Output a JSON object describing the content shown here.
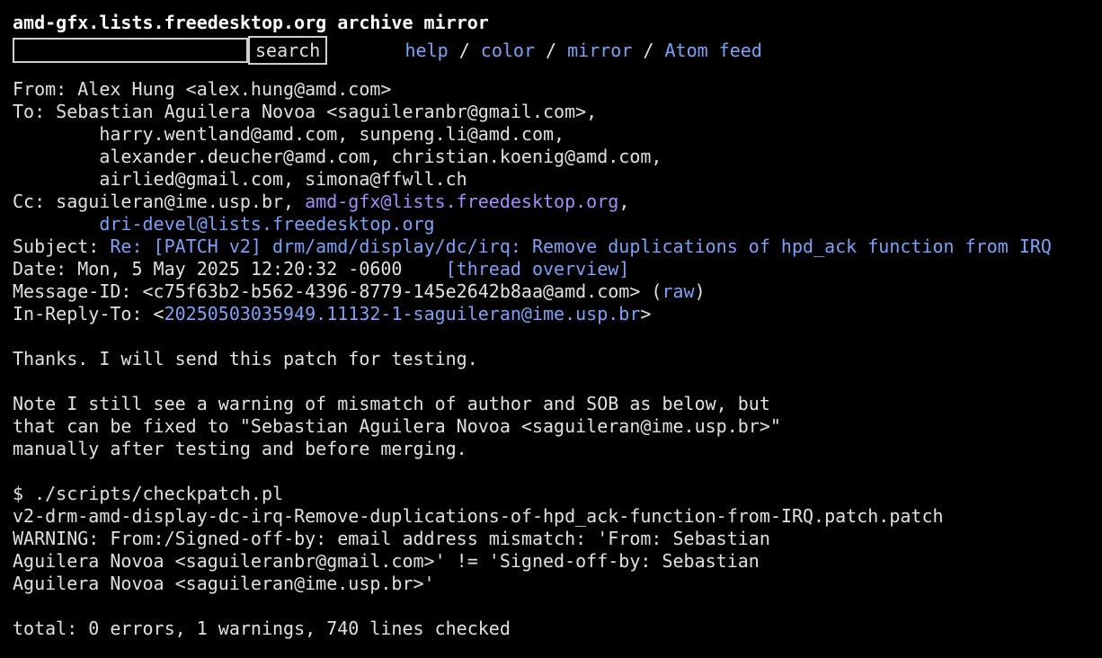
{
  "header": {
    "title": "amd-gfx.lists.freedesktop.org archive mirror",
    "search_button": "search",
    "search_value": "",
    "nav": [
      "help",
      "color",
      "mirror",
      "Atom feed"
    ],
    "sep": " / "
  },
  "message": {
    "from": "From: Alex Hung <alex.hung@amd.com>",
    "to_line1": "To: Sebastian Aguilera Novoa <saguileranbr@gmail.com>,",
    "to_line2": "        harry.wentland@amd.com, sunpeng.li@amd.com,",
    "to_line3": "        alexander.deucher@amd.com, christian.koenig@amd.com,",
    "to_line4": "        airlied@gmail.com, simona@ffwll.ch",
    "cc_prefix": "Cc: saguileran@ime.usp.br, ",
    "cc_link1": "amd-gfx@lists.freedesktop.org",
    "cc_sep": ",",
    "cc_indent": "        ",
    "cc_link2": "dri-devel@lists.freedesktop.org",
    "subject_prefix": "Subject: ",
    "subject_link": "Re: [PATCH v2] drm/amd/display/dc/irq: Remove duplications of hpd_ack function from IRQ",
    "date_text": "Date: Mon, 5 May 2025 12:20:32 -0600    ",
    "thread_overview": "[thread overview]",
    "message_id": "Message-ID: <c75f63b2-b562-4396-8779-145e2642b8aa@amd.com> (",
    "raw": "raw",
    "raw_close": ")",
    "in_reply_prefix": "In-Reply-To: <",
    "in_reply_link": "20250503035949.11132-1-saguileran@ime.usp.br",
    "in_reply_suffix": ">"
  },
  "body": [
    "Thanks. I will send this patch for testing.",
    "",
    "Note I still see a warning of mismatch of author and SOB as below, but",
    "that can be fixed to \"Sebastian Aguilera Novoa <saguileran@ime.usp.br>\"",
    "manually after testing and before merging.",
    "",
    "$ ./scripts/checkpatch.pl",
    "v2-drm-amd-display-dc-irq-Remove-duplications-of-hpd_ack-function-from-IRQ.patch.patch",
    "WARNING: From:/Signed-off-by: email address mismatch: 'From: Sebastian",
    "Aguilera Novoa <saguileranbr@gmail.com>' != 'Signed-off-by: Sebastian",
    "Aguilera Novoa <saguileran@ime.usp.br>'",
    "",
    "total: 0 errors, 1 warnings, 740 lines checked"
  ],
  "colors": {
    "background": "#000000",
    "text": "#e0e0e0",
    "link": "#7aa2f7",
    "visited_link": "#a78bfa"
  }
}
